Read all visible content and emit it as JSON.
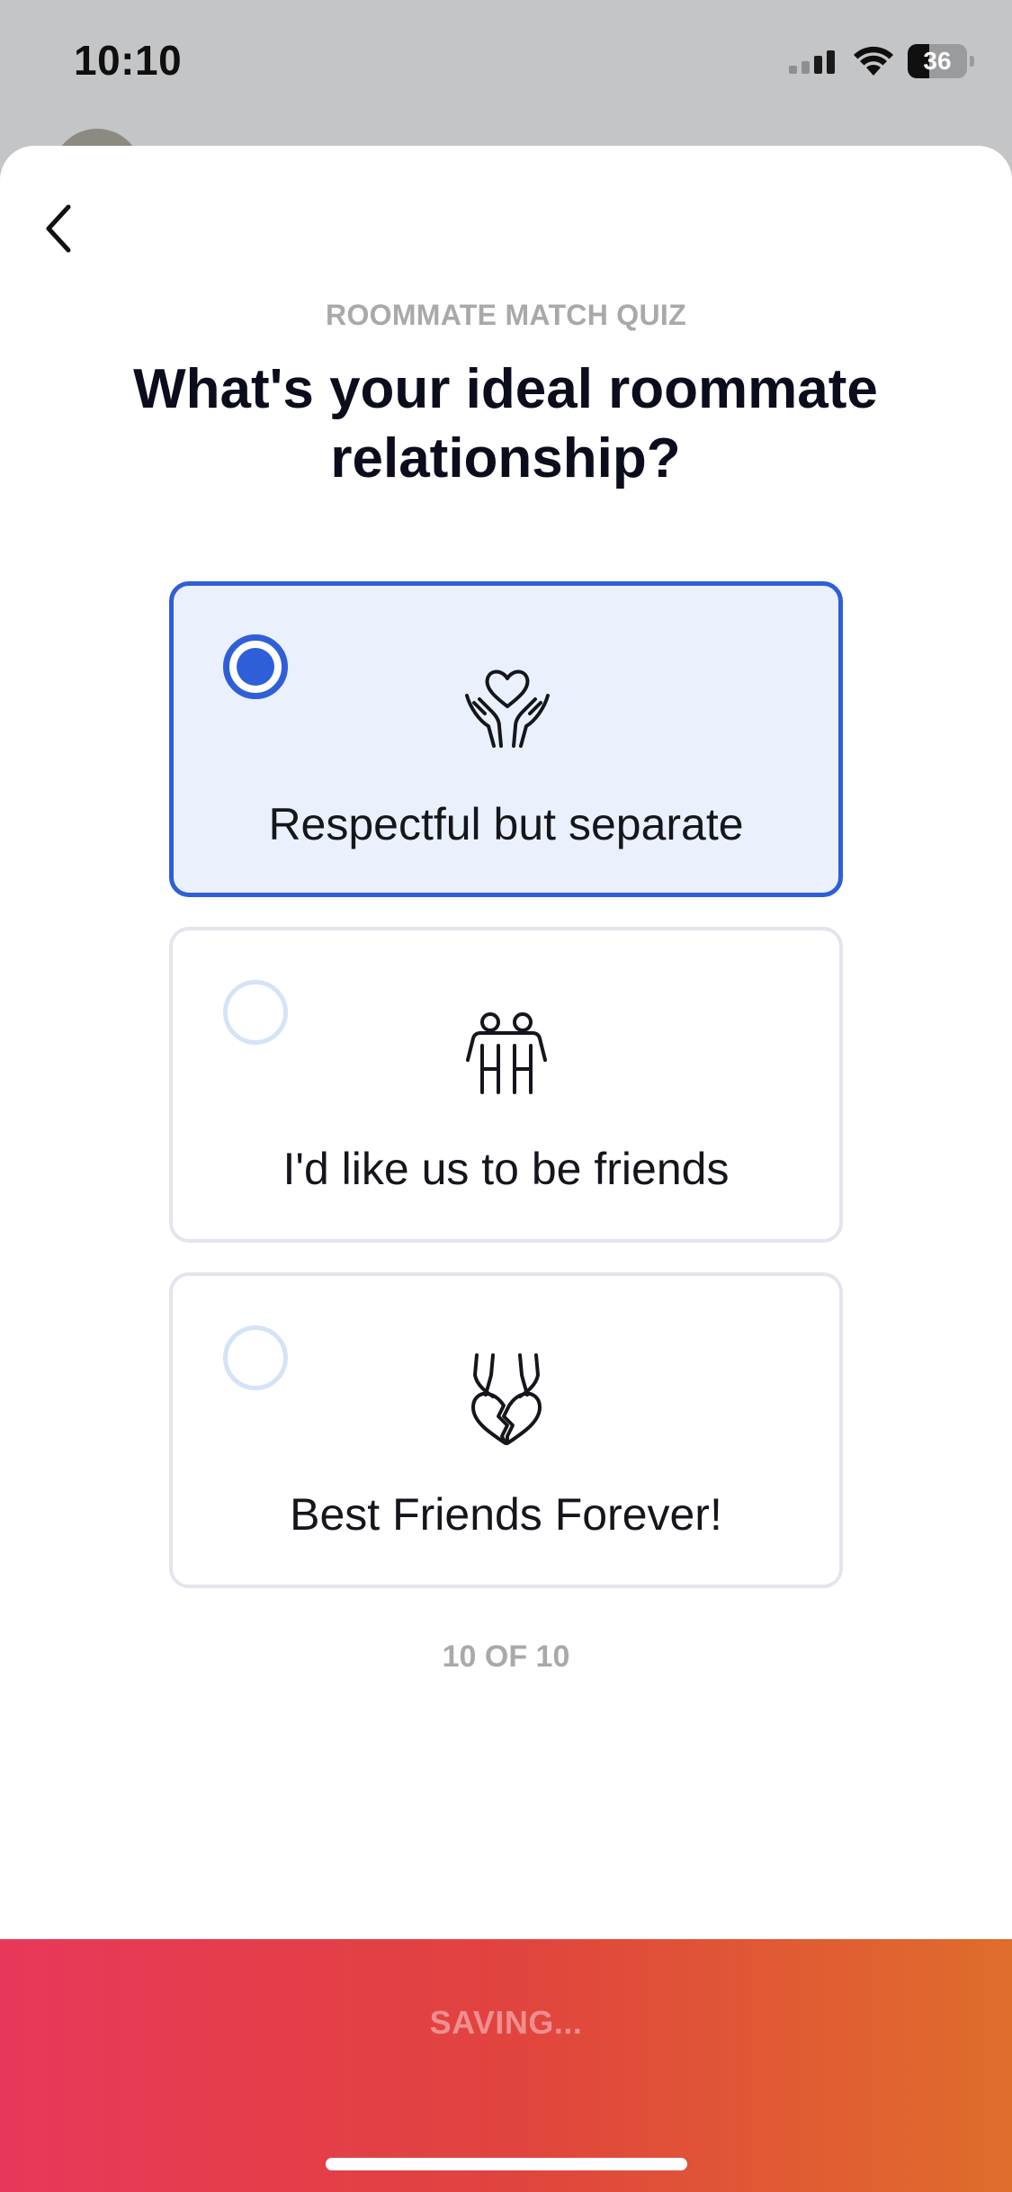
{
  "status_bar": {
    "time": "10:10",
    "battery": "36",
    "battery_level": 0.36
  },
  "nav": {
    "back_icon": "chevron-left-icon"
  },
  "quiz": {
    "label": "ROOMMATE MATCH QUIZ",
    "question": "What's your ideal roommate relationship?",
    "options": [
      {
        "label": "Respectful but separate",
        "icon": "heart-in-hands-icon",
        "selected": true
      },
      {
        "label": "I'd like us to be friends",
        "icon": "two-people-icon",
        "selected": false
      },
      {
        "label": "Best Friends Forever!",
        "icon": "split-heart-necklace-icon",
        "selected": false
      }
    ],
    "progress": "10 OF 10"
  },
  "cta": {
    "label": "SAVING..."
  },
  "colors": {
    "accent": "#2f5fd8",
    "selected_bg": "#ebf1fc",
    "gradient_start": "#e8385a",
    "gradient_end": "#df6d2b"
  }
}
